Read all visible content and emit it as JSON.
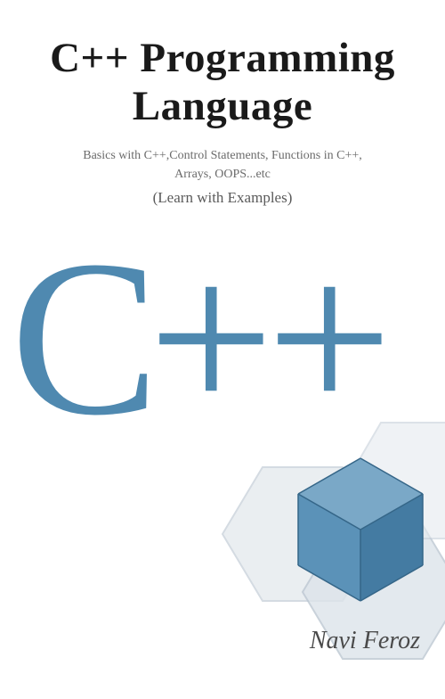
{
  "title_line1": "C++ Programming",
  "title_line2": "Language",
  "subtitle_line1": "Basics with C++,Control Statements, Functions in C++,",
  "subtitle_line2": "Arrays, OOPS...etc",
  "tagline": "(Learn with Examples)",
  "logo_text": "C++",
  "author": "Navi Feroz",
  "colors": {
    "logo_blue": "#4f89b0",
    "hex_fill": "#d8dfe6",
    "hex_stroke": "#b8c4d0",
    "cube_face1": "#6599be",
    "cube_face2": "#4f89b0",
    "cube_face3": "#3d6f94"
  }
}
